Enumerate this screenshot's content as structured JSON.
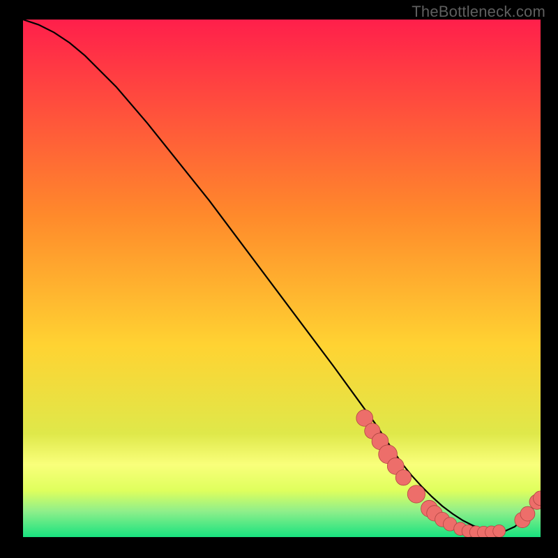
{
  "watermark": "TheBottleneck.com",
  "colors": {
    "page_bg": "#000000",
    "grad_top": "#ff1f4b",
    "grad_mid": "#ffd332",
    "grad_low": "#dfff5d",
    "grad_yellow_band": "#f9ff7b",
    "grad_green": "#18e27f",
    "curve": "#000000",
    "marker_fill": "#ed6e6a",
    "marker_stroke": "#b04542",
    "watermark": "#5f5f5f"
  },
  "chart_data": {
    "type": "line",
    "title": "",
    "xlabel": "",
    "ylabel": "",
    "xlim": [
      0,
      100
    ],
    "ylim": [
      0,
      100
    ],
    "series": [
      {
        "name": "bottleneck-curve",
        "x": [
          0,
          3,
          6,
          9,
          12,
          18,
          24,
          30,
          36,
          42,
          48,
          54,
          60,
          64,
          68,
          71,
          73,
          75,
          77,
          79,
          81,
          83,
          85,
          87,
          89,
          91,
          93,
          95,
          96.5,
          98,
          100
        ],
        "y": [
          100,
          99,
          97.5,
          95.5,
          93,
          87,
          80,
          72.5,
          65,
          57,
          49,
          41,
          33,
          27.5,
          22,
          17.5,
          14.5,
          12,
          9.8,
          7.8,
          6,
          4.5,
          3.2,
          2.2,
          1.5,
          1,
          1.1,
          2,
          3.3,
          5,
          7.5
        ]
      }
    ],
    "markers": [
      {
        "x": 66,
        "y": 23,
        "r": 1.2
      },
      {
        "x": 67.5,
        "y": 20.5,
        "r": 1.1
      },
      {
        "x": 69,
        "y": 18.5,
        "r": 1.2
      },
      {
        "x": 70.5,
        "y": 16,
        "r": 1.4
      },
      {
        "x": 72,
        "y": 13.7,
        "r": 1.2
      },
      {
        "x": 73.5,
        "y": 11.5,
        "r": 1.1
      },
      {
        "x": 76,
        "y": 8.3,
        "r": 1.3
      },
      {
        "x": 78.5,
        "y": 5.5,
        "r": 1.2
      },
      {
        "x": 79.5,
        "y": 4.6,
        "r": 1.1
      },
      {
        "x": 81,
        "y": 3.4,
        "r": 1.0
      },
      {
        "x": 82.5,
        "y": 2.5,
        "r": 0.9
      },
      {
        "x": 84.5,
        "y": 1.6,
        "r": 0.85
      },
      {
        "x": 86,
        "y": 1.15,
        "r": 0.8
      },
      {
        "x": 87.5,
        "y": 0.95,
        "r": 0.8
      },
      {
        "x": 89,
        "y": 0.9,
        "r": 0.8
      },
      {
        "x": 90.5,
        "y": 0.95,
        "r": 0.8
      },
      {
        "x": 92,
        "y": 1.15,
        "r": 0.8
      },
      {
        "x": 96.5,
        "y": 3.3,
        "r": 1.1
      },
      {
        "x": 97.5,
        "y": 4.5,
        "r": 1.0
      },
      {
        "x": 99.3,
        "y": 6.8,
        "r": 1.05
      },
      {
        "x": 100,
        "y": 7.5,
        "r": 1.0
      }
    ]
  }
}
